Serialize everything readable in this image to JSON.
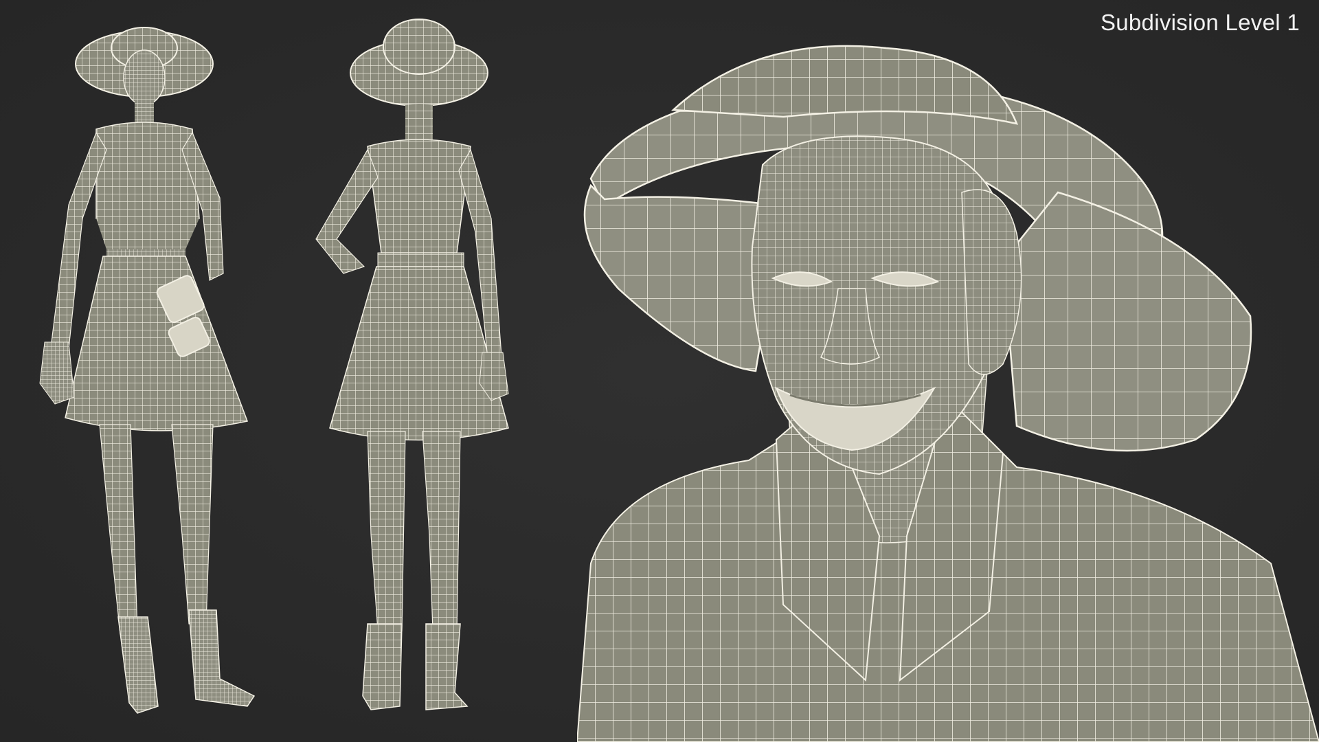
{
  "overlay": {
    "subdivision_label": "Subdivision Level 1"
  },
  "colors": {
    "background": "#2b2b2b",
    "mesh_fill": "#8f8f80",
    "mesh_shade": "#6f6f62",
    "wire": "#f4f1e6",
    "label_text": "#f2f2f2"
  },
  "views": [
    {
      "name": "front-three-quarter-view"
    },
    {
      "name": "back-view"
    },
    {
      "name": "head-closeup-view"
    }
  ]
}
